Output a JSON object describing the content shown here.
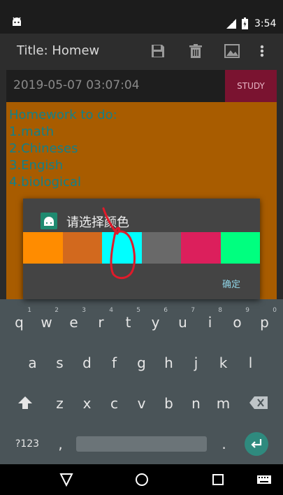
{
  "status_bar": {
    "network": "LTE",
    "time": "3:54"
  },
  "action_bar": {
    "title": "Title: Homew"
  },
  "date_row": {
    "date": "2019-05-07 03:07:04",
    "study_label": "STUDY"
  },
  "note": {
    "lines": [
      "Homework to do:",
      "1.math",
      "2.Chineses",
      "3.Engish",
      "4.biological"
    ]
  },
  "dialog": {
    "title": "请选择颜色",
    "swatch_colors": [
      "#ff8c00",
      "#d2691e",
      "#00ffff",
      "#696969",
      "#dc1f5c",
      "#00ff7f"
    ],
    "ok_label": "确定"
  },
  "keyboard": {
    "row1": [
      "q",
      "w",
      "e",
      "r",
      "t",
      "y",
      "u",
      "i",
      "o",
      "p"
    ],
    "row1_hints": [
      "1",
      "2",
      "3",
      "4",
      "5",
      "6",
      "7",
      "8",
      "9",
      "0"
    ],
    "row2": [
      "a",
      "s",
      "d",
      "f",
      "g",
      "h",
      "j",
      "k",
      "l"
    ],
    "row3": [
      "z",
      "x",
      "c",
      "v",
      "b",
      "n",
      "m"
    ],
    "mode_key": "?123",
    "comma": ",",
    "period": "."
  },
  "colors": {
    "note_bg": "#a85c00",
    "note_text": "#12808a",
    "study_bg": "#7a1330",
    "keyboard_bg": "#4a5458",
    "enter_key": "#2f8a7e"
  },
  "icons": [
    "android-app-icon",
    "lte-signal-icon",
    "battery-icon",
    "save-icon",
    "delete-icon",
    "image-icon",
    "overflow-menu-icon",
    "shift-icon",
    "backspace-icon",
    "enter-icon",
    "back-triangle-icon",
    "home-circle-icon",
    "recents-square-icon",
    "keyboard-switch-icon"
  ]
}
